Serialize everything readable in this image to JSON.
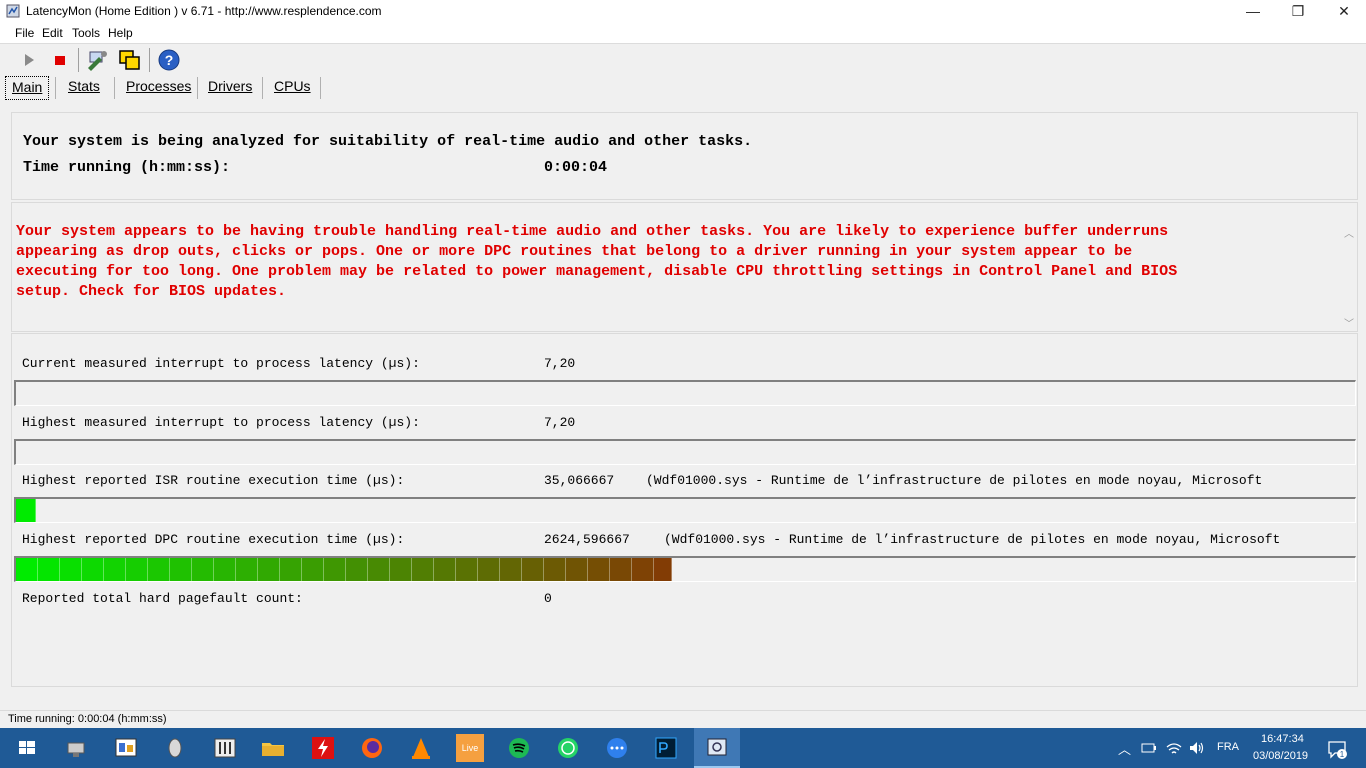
{
  "window": {
    "title": "LatencyMon  (Home Edition )  v 6.71 - http://www.resplendence.com",
    "minimize_glyph": "—",
    "maximize_glyph": "❐",
    "close_glyph": "✕"
  },
  "menu": {
    "file": "File",
    "edit": "Edit",
    "tools": "Tools",
    "help": "Help"
  },
  "toolbar": {
    "play_icon": "play-icon",
    "stop_icon": "stop-icon",
    "help_glyph": "?"
  },
  "tabs": [
    {
      "label": "Main"
    },
    {
      "label": "Stats"
    },
    {
      "label": "Processes"
    },
    {
      "label": "Drivers"
    },
    {
      "label": "CPUs"
    }
  ],
  "status_panel": {
    "analyzing_text": "Your system is being analyzed for suitability of real-time audio and other tasks.",
    "time_label": "Time running (h:mm:ss):",
    "time_value": "0:00:04"
  },
  "verdict": {
    "line1": "Your system appears to be having trouble handling real-time audio and other tasks. You are likely to experience buffer underruns",
    "line2": "appearing as drop outs, clicks or pops. One or more DPC routines that belong to a driver running in your system appear to be",
    "line3": "executing for too long. One problem may be related to power management, disable CPU throttling settings in Control Panel and BIOS",
    "line4": "setup. Check for BIOS updates.",
    "color": "#e00000"
  },
  "metrics": {
    "current_latency_label": "Current measured interrupt to process latency (µs):",
    "current_latency_value": "7,20",
    "current_latency_level": 0,
    "highest_latency_label": "Highest measured interrupt to process latency (µs):",
    "highest_latency_value": "7,20",
    "highest_latency_level": 0,
    "isr_label": "Highest reported ISR routine execution time (µs):",
    "isr_value": "35,066667",
    "isr_detail": "(Wdf01000.sys - Runtime de l’infrastructure de pilotes en mode noyau, Microsoft",
    "isr_level": 0.015,
    "dpc_label": "Highest reported DPC routine execution time (µs):",
    "dpc_value": "2624,596667",
    "dpc_detail": "(Wdf01000.sys - Runtime de l’infrastructure de pilotes en mode noyau, Microsoft",
    "dpc_level": 0.49,
    "pagefault_label": "Reported total hard pagefault count:",
    "pagefault_value": "0"
  },
  "statusbar": {
    "text": "Time running: 0:00:04  (h:mm:ss)"
  },
  "taskbar": {
    "language": "FRA",
    "time": "16:47:34",
    "date": "03/08/2019",
    "notifications": "1",
    "live_label": "Live"
  }
}
